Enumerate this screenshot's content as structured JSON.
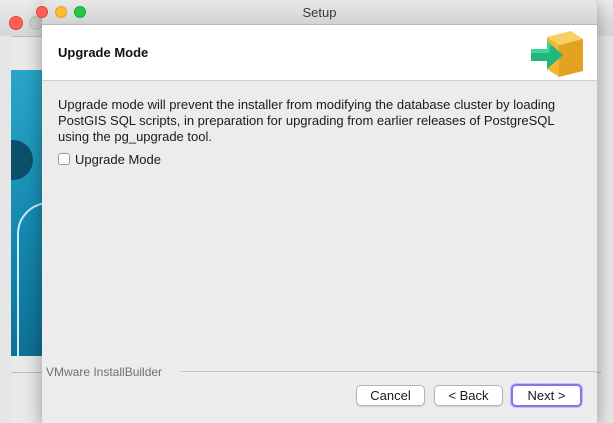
{
  "window": {
    "title": "Setup"
  },
  "header": {
    "title": "Upgrade Mode",
    "icon": "installer-box-arrow-icon"
  },
  "content": {
    "description": "Upgrade mode will prevent the installer from modifying the database cluster by loading PostGIS SQL scripts, in preparation for upgrading from earlier releases of PostgreSQL using the pg_upgrade tool.",
    "checkbox_label": "Upgrade Mode",
    "checkbox_checked": false
  },
  "footer": {
    "brand": "VMware InstallBuilder",
    "buttons": {
      "cancel": "Cancel",
      "back": "< Back",
      "next": "Next >"
    }
  },
  "colors": {
    "close": "#fe5f57",
    "minimize": "#febc2e",
    "zoom": "#28c840",
    "focus_ring": "#8a72e8",
    "icon_box": "#f2b632",
    "icon_arrow": "#1fb87a"
  }
}
